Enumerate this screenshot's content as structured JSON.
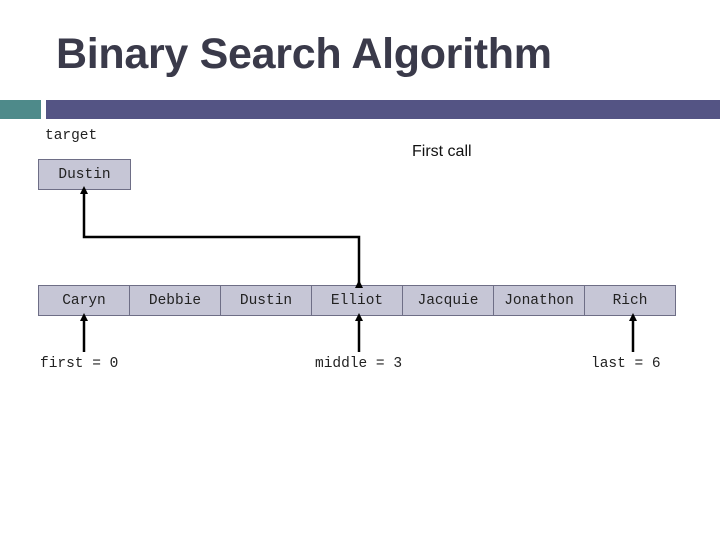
{
  "slide": {
    "title": "Binary Search Algorithm",
    "caption": "First call",
    "accent_colors": {
      "teal": "#4e8a8a",
      "purple": "#545484",
      "cell_fill": "#c6c6d6",
      "cell_border": "#6e6e86"
    }
  },
  "target": {
    "label": "target",
    "value": "Dustin"
  },
  "array": {
    "cells": [
      "Caryn",
      "Debbie",
      "Dustin",
      "Elliot",
      "Jacquie",
      "Jonathon",
      "Rich"
    ]
  },
  "pointers": {
    "first": {
      "label": "first = 0",
      "index": 0
    },
    "middle": {
      "label": "middle = 3",
      "index": 3
    },
    "last": {
      "label": "last = 6",
      "index": 6
    }
  },
  "comparison": {
    "from_index": 3,
    "to": "target"
  }
}
